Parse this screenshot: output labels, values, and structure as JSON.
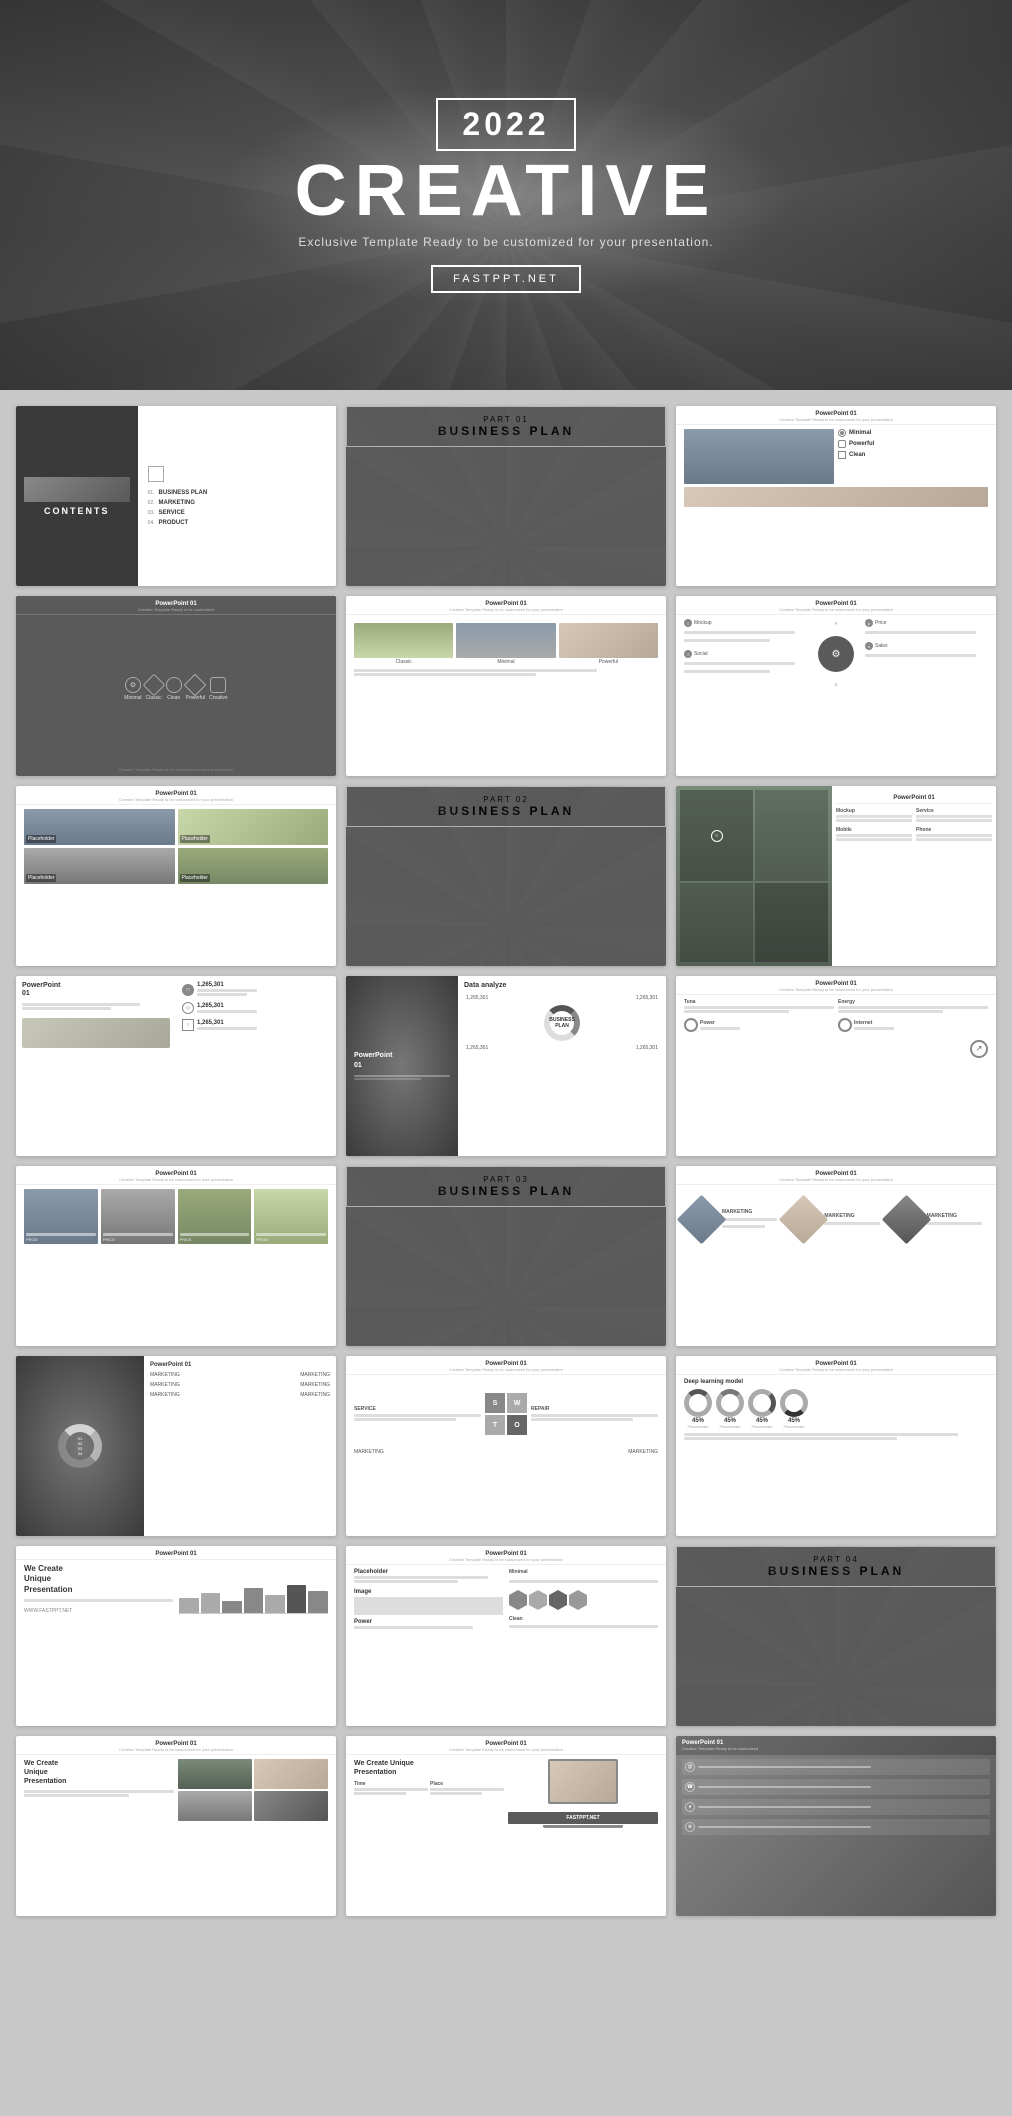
{
  "hero": {
    "year": "2022",
    "title": "CREATIVE",
    "subtitle": "Exclusive Template Ready to be customized for your presentation.",
    "brand": "FASTPPT.NET"
  },
  "slides": [
    {
      "id": "s1",
      "type": "contents",
      "label": "CONTENTS"
    },
    {
      "id": "s2",
      "type": "part-dark",
      "part": "PART 01",
      "title": "BUSINESS PLAN"
    },
    {
      "id": "s3",
      "type": "powerpoint",
      "title": "PowerPoint 01",
      "sub": "Minimal / Powerful / Clean"
    },
    {
      "id": "s4",
      "type": "powerpoint",
      "title": "PowerPoint 01",
      "icons": [
        "Minimal",
        "Classic",
        "Clean",
        "Powerful",
        "Creative"
      ]
    },
    {
      "id": "s5",
      "type": "powerpoint",
      "title": "PowerPoint 01",
      "thumbs": [
        "Classic",
        "Minimal",
        "Powerful"
      ]
    },
    {
      "id": "s6",
      "type": "powerpoint",
      "title": "PowerPoint 01",
      "diagram": "gear-social"
    },
    {
      "id": "s7",
      "type": "powerpoint",
      "title": "PowerPoint 01",
      "content": "grid-images"
    },
    {
      "id": "s8",
      "type": "part-dark",
      "part": "PART 02",
      "title": "BUSINESS PLAN"
    },
    {
      "id": "s9",
      "type": "powerpoint",
      "title": "PowerPoint 01",
      "content": "service-grid"
    },
    {
      "id": "s10",
      "type": "powerpoint",
      "title": "PowerPoint 01",
      "content": "stats-list"
    },
    {
      "id": "s11",
      "type": "powerpoint-dark-left",
      "title": "PowerPoint 01",
      "content": "data-analyze"
    },
    {
      "id": "s12",
      "type": "powerpoint",
      "title": "PowerPoint 01",
      "content": "data-analyze-right"
    },
    {
      "id": "s13",
      "type": "powerpoint",
      "title": "PowerPoint 01",
      "content": "4-cols-images"
    },
    {
      "id": "s14",
      "type": "part-dark",
      "part": "PART 03",
      "title": "BUSINESS PLAN"
    },
    {
      "id": "s15",
      "type": "powerpoint",
      "title": "PowerPoint 01",
      "content": "diamond-images"
    },
    {
      "id": "s16",
      "type": "powerpoint",
      "title": "PowerPoint 01",
      "content": "donut-marketing"
    },
    {
      "id": "s17",
      "type": "powerpoint",
      "title": "PowerPoint 01",
      "content": "swot"
    },
    {
      "id": "s18",
      "type": "powerpoint",
      "title": "PowerPoint 01",
      "content": "deep-learning"
    },
    {
      "id": "s19",
      "type": "powerpoint",
      "title": "PowerPoint 01",
      "content": "bar-chart-pres"
    },
    {
      "id": "s20",
      "type": "powerpoint",
      "title": "PowerPoint 01",
      "content": "hexagons"
    },
    {
      "id": "s21",
      "type": "part-dark",
      "part": "PART 04",
      "title": "BUSINESS PLAN"
    },
    {
      "id": "s22",
      "type": "powerpoint",
      "title": "PowerPoint 01",
      "content": "people-photos"
    },
    {
      "id": "s23",
      "type": "powerpoint",
      "title": "PowerPoint 01",
      "content": "laptop-pres"
    },
    {
      "id": "s24",
      "type": "powerpoint",
      "title": "PowerPoint 01",
      "content": "contact-list"
    }
  ],
  "menu_items": [
    {
      "num": "01.",
      "text": "BUSINESS PLAN",
      "sub": ""
    },
    {
      "num": "02.",
      "text": "MARKETING",
      "sub": ""
    },
    {
      "num": "03.",
      "text": "SERVICE",
      "sub": ""
    },
    {
      "num": "04.",
      "text": "PRODUCT",
      "sub": ""
    }
  ],
  "swot_label": "PowerPoint 01 SwOT"
}
